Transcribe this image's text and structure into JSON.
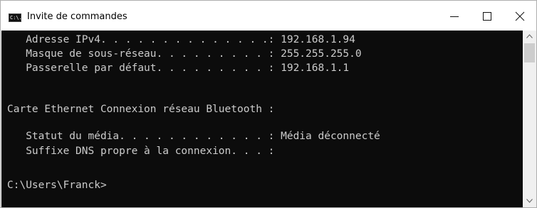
{
  "window": {
    "title": "Invite de commandes",
    "icon": "cmd-icon",
    "icon_text": "C:\\."
  },
  "controls": {
    "minimize": "minimize-icon",
    "maximize": "maximize-icon",
    "close": "close-icon"
  },
  "console": {
    "lines": [
      "   Adresse IPv4. . . . . . . . . . . . . .: 192.168.1.94",
      "   Masque de sous-réseau. . . . . . . . . : 255.255.255.0",
      "   Passerelle par défaut. . . . . . . . . : 192.168.1.1",
      "Carte Ethernet Connexion réseau Bluetooth :",
      "   Statut du média. . . . . . . . . . . . : Média déconnecté",
      "   Suffixe DNS propre à la connexion. . . :",
      "C:\\Users\\Franck>"
    ]
  },
  "colors": {
    "console_bg": "#0c0c0c",
    "console_fg": "#cccccc"
  }
}
